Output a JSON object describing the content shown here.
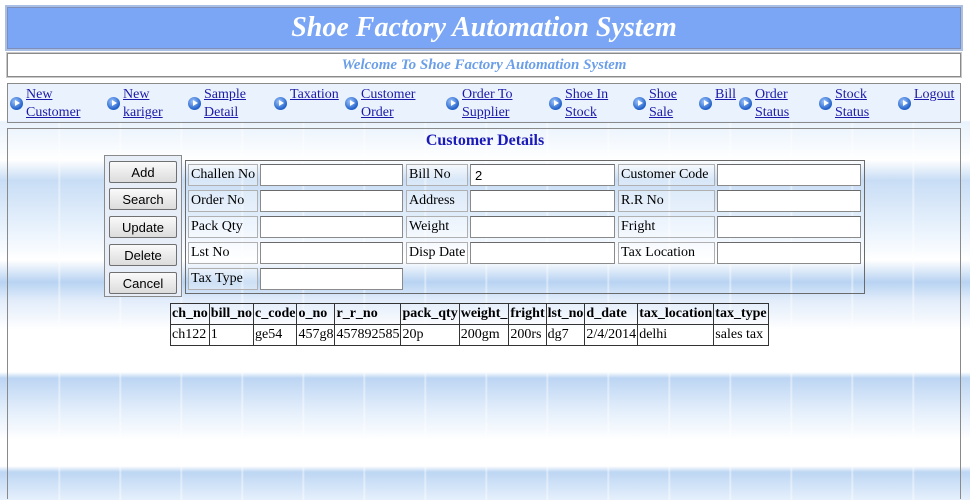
{
  "header": {
    "title": "Shoe Factory Automation System"
  },
  "welcome": {
    "text": "Welcome To Shoe Factory Automation System"
  },
  "nav": {
    "items": [
      {
        "label": "New\nCustomer"
      },
      {
        "label": "New\nkariger"
      },
      {
        "label": "Sample\nDetail"
      },
      {
        "label": "Taxation"
      },
      {
        "label": "Customer\nOrder"
      },
      {
        "label": "Order To\nSupplier"
      },
      {
        "label": "Shoe In\nStock"
      },
      {
        "label": "Shoe\nSale"
      },
      {
        "label": "Bill"
      },
      {
        "label": "Order\nStatus"
      },
      {
        "label": "Stock\nStatus"
      },
      {
        "label": "Logout"
      }
    ]
  },
  "section": {
    "title": "Customer Details"
  },
  "buttons": {
    "add": "Add",
    "search": "Search",
    "update": "Update",
    "delete": "Delete",
    "cancel": "Cancel"
  },
  "form": {
    "challen_no": {
      "label": "Challen No",
      "value": ""
    },
    "bill_no": {
      "label": "Bill No",
      "value": "2"
    },
    "customer_code": {
      "label": "Customer Code",
      "value": ""
    },
    "order_no": {
      "label": "Order No",
      "value": ""
    },
    "address": {
      "label": "Address",
      "value": ""
    },
    "rr_no": {
      "label": "R.R No",
      "value": ""
    },
    "pack_qty": {
      "label": "Pack Qty",
      "value": ""
    },
    "weight": {
      "label": "Weight",
      "value": ""
    },
    "fright": {
      "label": "Fright",
      "value": ""
    },
    "lst_no": {
      "label": "Lst No",
      "value": ""
    },
    "disp_date": {
      "label": "Disp Date",
      "value": ""
    },
    "tax_location": {
      "label": "Tax Location",
      "value": ""
    },
    "tax_type": {
      "label": "Tax Type",
      "value": ""
    }
  },
  "table": {
    "columns": [
      "ch_no",
      "bill_no",
      "c_code",
      "o_no",
      "r_r_no",
      "pack_qty",
      "weight_",
      "fright",
      "lst_no",
      "d_date",
      "tax_location",
      "tax_type"
    ],
    "rows": [
      [
        "ch122",
        "1",
        "ge54",
        "457g8",
        "457892585",
        "20p",
        "200gm",
        "200rs",
        "dg7",
        "2/4/2014",
        "delhi",
        "sales tax"
      ]
    ]
  },
  "colors": {
    "header_bg": "#7ba6f5",
    "link": "#1a1aa8",
    "section_title": "#1a1ab8",
    "welcome": "#6b9ee8"
  }
}
